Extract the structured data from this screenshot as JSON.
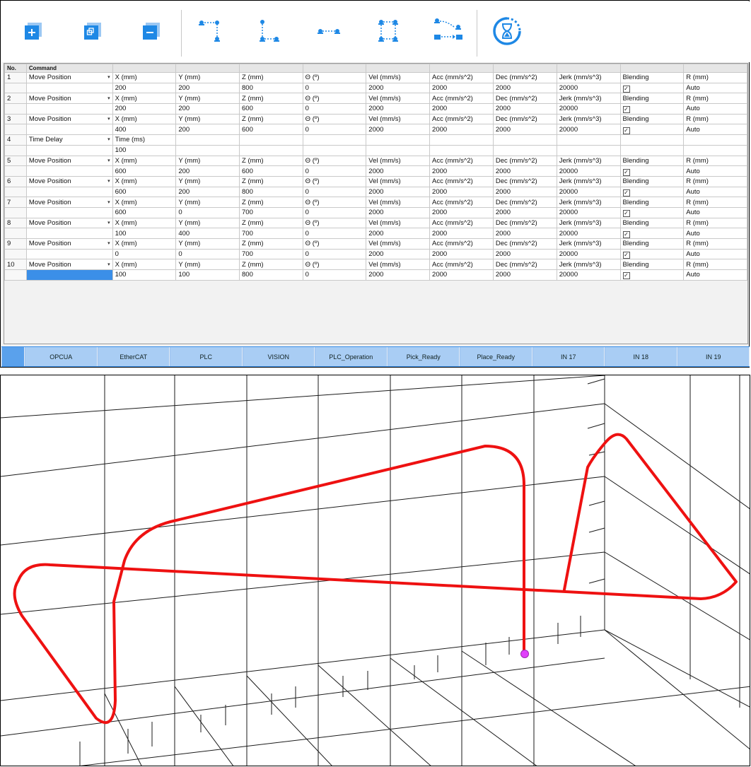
{
  "colors": {
    "accent": "#1e88e5",
    "io_bar": "#3b8fe8",
    "io_button": "#a9cdf4",
    "path": "#ee1111",
    "marker": "#e040fb"
  },
  "toolbar": {
    "buttons": [
      {
        "name": "add-command-button",
        "icon": "add-icon"
      },
      {
        "name": "copy-command-button",
        "icon": "copy-icon"
      },
      {
        "name": "remove-command-button",
        "icon": "remove-icon"
      },
      {
        "name": "motion-template-1-button",
        "icon": "motion-path-icon"
      },
      {
        "name": "motion-template-2-button",
        "icon": "motion-l-path-icon"
      },
      {
        "name": "motion-template-3-button",
        "icon": "motion-linear-icon"
      },
      {
        "name": "motion-template-4-button",
        "icon": "motion-box-path-icon"
      },
      {
        "name": "pick-place-button",
        "icon": "pick-place-icon"
      },
      {
        "name": "time-delay-button",
        "icon": "hourglass-icon"
      }
    ]
  },
  "table": {
    "headers": [
      "No.",
      "Command"
    ],
    "rows": [
      {
        "no": "1",
        "command": "Move Position",
        "labels": [
          "X (mm)",
          "Y (mm)",
          "Z (mm)",
          "Θ (º)",
          "Vel (mm/s)",
          "Acc (mm/s^2)",
          "Dec (mm/s^2)",
          "Jerk (mm/s^3)",
          "Blending",
          "R (mm)"
        ],
        "values": [
          "200",
          "200",
          "800",
          "0",
          "2000",
          "2000",
          "2000",
          "20000",
          "",
          "Auto"
        ]
      },
      {
        "no": "2",
        "command": "Move Position",
        "labels": [
          "X (mm)",
          "Y (mm)",
          "Z (mm)",
          "Θ (º)",
          "Vel (mm/s)",
          "Acc (mm/s^2)",
          "Dec (mm/s^2)",
          "Jerk (mm/s^3)",
          "Blending",
          "R (mm)"
        ],
        "values": [
          "200",
          "200",
          "600",
          "0",
          "2000",
          "2000",
          "2000",
          "20000",
          "",
          "Auto"
        ]
      },
      {
        "no": "3",
        "command": "Move Position",
        "labels": [
          "X (mm)",
          "Y (mm)",
          "Z (mm)",
          "Θ (º)",
          "Vel (mm/s)",
          "Acc (mm/s^2)",
          "Dec (mm/s^2)",
          "Jerk (mm/s^3)",
          "Blending",
          "R (mm)"
        ],
        "values": [
          "400",
          "200",
          "600",
          "0",
          "2000",
          "2000",
          "2000",
          "20000",
          "",
          "Auto"
        ]
      },
      {
        "no": "4",
        "command": "Time Delay",
        "labels": [
          "Time (ms)",
          "",
          "",
          "",
          "",
          "",
          "",
          "",
          "",
          ""
        ],
        "values": [
          "100",
          "",
          "",
          "",
          "",
          "",
          "",
          "",
          "",
          ""
        ]
      },
      {
        "no": "5",
        "command": "Move Position",
        "labels": [
          "X (mm)",
          "Y (mm)",
          "Z (mm)",
          "Θ (º)",
          "Vel (mm/s)",
          "Acc (mm/s^2)",
          "Dec (mm/s^2)",
          "Jerk (mm/s^3)",
          "Blending",
          "R (mm)"
        ],
        "values": [
          "600",
          "200",
          "600",
          "0",
          "2000",
          "2000",
          "2000",
          "20000",
          "",
          "Auto"
        ]
      },
      {
        "no": "6",
        "command": "Move Position",
        "labels": [
          "X (mm)",
          "Y (mm)",
          "Z (mm)",
          "Θ (º)",
          "Vel (mm/s)",
          "Acc (mm/s^2)",
          "Dec (mm/s^2)",
          "Jerk (mm/s^3)",
          "Blending",
          "R (mm)"
        ],
        "values": [
          "600",
          "200",
          "800",
          "0",
          "2000",
          "2000",
          "2000",
          "20000",
          "",
          "Auto"
        ]
      },
      {
        "no": "7",
        "command": "Move Position",
        "labels": [
          "X (mm)",
          "Y (mm)",
          "Z (mm)",
          "Θ (º)",
          "Vel (mm/s)",
          "Acc (mm/s^2)",
          "Dec (mm/s^2)",
          "Jerk (mm/s^3)",
          "Blending",
          "R (mm)"
        ],
        "values": [
          "600",
          "0",
          "700",
          "0",
          "2000",
          "2000",
          "2000",
          "20000",
          "",
          "Auto"
        ]
      },
      {
        "no": "8",
        "command": "Move Position",
        "labels": [
          "X (mm)",
          "Y (mm)",
          "Z (mm)",
          "Θ (º)",
          "Vel (mm/s)",
          "Acc (mm/s^2)",
          "Dec (mm/s^2)",
          "Jerk (mm/s^3)",
          "Blending",
          "R (mm)"
        ],
        "values": [
          "100",
          "400",
          "700",
          "0",
          "2000",
          "2000",
          "2000",
          "20000",
          "",
          "Auto"
        ]
      },
      {
        "no": "9",
        "command": "Move Position",
        "labels": [
          "X (mm)",
          "Y (mm)",
          "Z (mm)",
          "Θ (º)",
          "Vel (mm/s)",
          "Acc (mm/s^2)",
          "Dec (mm/s^2)",
          "Jerk (mm/s^3)",
          "Blending",
          "R (mm)"
        ],
        "values": [
          "0",
          "0",
          "700",
          "0",
          "2000",
          "2000",
          "2000",
          "20000",
          "",
          "Auto"
        ]
      },
      {
        "no": "10",
        "command": "Move Position",
        "labels": [
          "X (mm)",
          "Y (mm)",
          "Z (mm)",
          "Θ (º)",
          "Vel (mm/s)",
          "Acc (mm/s^2)",
          "Dec (mm/s^2)",
          "Jerk (mm/s^3)",
          "Blending",
          "R (mm)"
        ],
        "values": [
          "100",
          "100",
          "800",
          "0",
          "2000",
          "2000",
          "2000",
          "20000",
          "",
          "Auto"
        ]
      }
    ]
  },
  "io_bar": {
    "buttons": [
      "OPCUA",
      "EtherCAT",
      "PLC",
      "VISION",
      "PLC_Operation",
      "Pick_Ready",
      "Place_Ready",
      "IN 17",
      "IN 18",
      "IN 19"
    ]
  }
}
